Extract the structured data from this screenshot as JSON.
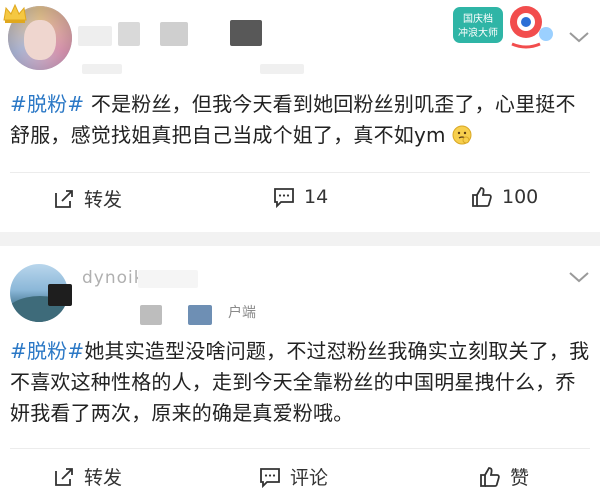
{
  "colors": {
    "topic": "#2b78c6",
    "text": "#222222",
    "muted": "#8a8a8a",
    "gap": "#f2f2f2"
  },
  "posts": [
    {
      "avatar_icon": "crown-icon",
      "badge_icon": "national-day-badge-icon",
      "badge_text": [
        "国庆档",
        "冲浪大师"
      ],
      "topic": "#脱粉#",
      "body": " 不是粉丝，但我今天看到她回粉丝别叽歪了，心里挺不舒服，感觉找姐真把自己当成个姐了，真不如ym",
      "emoji_icon": "thinking-emoji-icon",
      "actions": {
        "share": "转发",
        "comments": "14",
        "likes": "100"
      }
    },
    {
      "username_partial": "dynoiku",
      "source_partial": "户端",
      "topic": "#脱粉#",
      "body": "她其实造型没啥问题，不过怼粉丝我确实立刻取关了，我不喜欢这种性格的人，走到今天全靠粉丝的中国明星拽什么，乔妍我看了两次，原来的确是真爱粉哦。",
      "actions": {
        "share": "转发",
        "comments": "评论",
        "likes": "赞"
      }
    }
  ]
}
